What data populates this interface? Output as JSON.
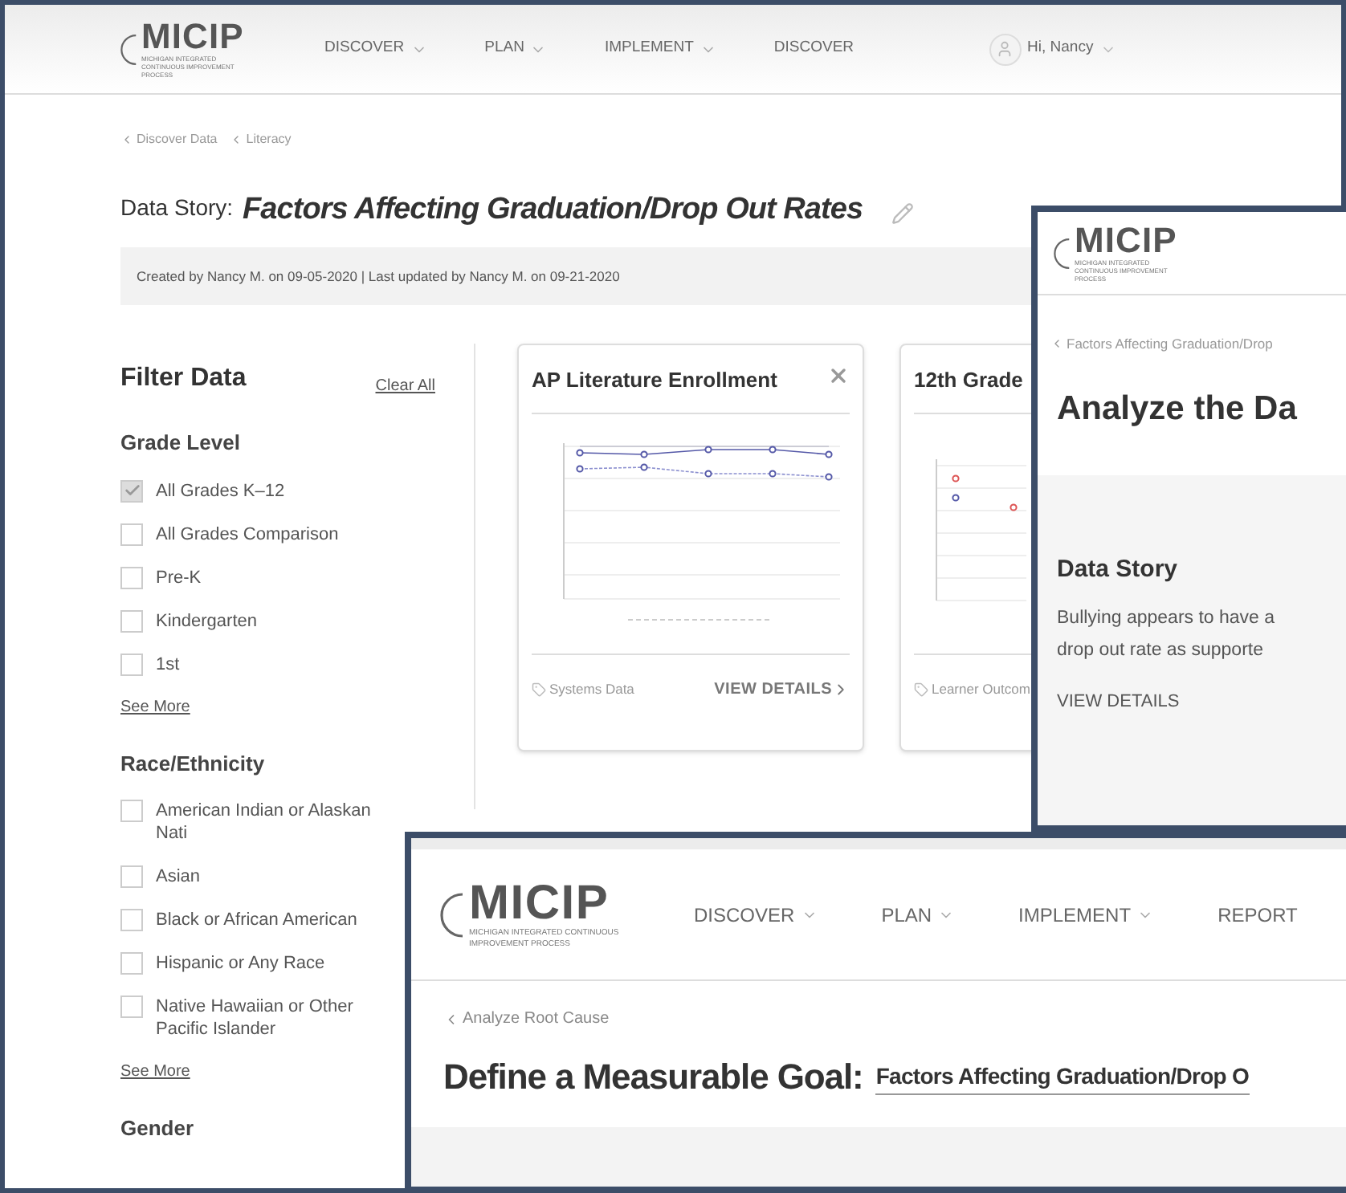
{
  "data_story_window": {
    "logo": {
      "name": "MICIP",
      "subtitle": "MICHIGAN INTEGRATED CONTINUOUS IMPROVEMENT PROCESS"
    },
    "nav": [
      {
        "label": "DISCOVER",
        "dropdown": true
      },
      {
        "label": "PLAN",
        "dropdown": true
      },
      {
        "label": "IMPLEMENT",
        "dropdown": true
      },
      {
        "label": "DISCOVER",
        "dropdown": false
      }
    ],
    "user": {
      "greeting": "Hi, Nancy"
    },
    "breadcrumbs": [
      "Discover Data",
      "Literacy"
    ],
    "title": {
      "prefix": "Data Story:",
      "name": "Factors Affecting Graduation/Drop Out Rates"
    },
    "meta": "Created by Nancy M. on 09-05-2020 | Last updated by Nancy M. on 09-21-2020",
    "filters": {
      "title": "Filter Data",
      "clear": "Clear All",
      "groups": [
        {
          "heading": "Grade Level",
          "options": [
            {
              "label": "All Grades K–12",
              "checked": true
            },
            {
              "label": "All Grades Comparison",
              "checked": false
            },
            {
              "label": "Pre-K",
              "checked": false
            },
            {
              "label": "Kindergarten",
              "checked": false
            },
            {
              "label": "1st",
              "checked": false
            }
          ],
          "see_more": "See More"
        },
        {
          "heading": "Race/Ethnicity",
          "options": [
            {
              "label": "American Indian or Alaskan Nati",
              "checked": false
            },
            {
              "label": "Asian",
              "checked": false
            },
            {
              "label": "Black or African American",
              "checked": false
            },
            {
              "label": "Hispanic or Any Race",
              "checked": false
            },
            {
              "label": "Native Hawaiian or Other Pacific Islander",
              "checked": false
            }
          ],
          "see_more": "See More"
        },
        {
          "heading": "Gender"
        }
      ]
    },
    "cards": [
      {
        "title": "AP Literature Enrollment",
        "closable": true,
        "tag": "Systems Data",
        "action": "VIEW DETAILS"
      },
      {
        "title": "12th Grade",
        "tag": "Learner Outcom"
      }
    ]
  },
  "analyze_window": {
    "logo": {
      "name": "MICIP",
      "subtitle": "MICHIGAN INTEGRATED CONTINUOUS IMPROVEMENT PROCESS"
    },
    "breadcrumb": "Factors Affecting Graduation/Drop",
    "heading": "Analyze the Da",
    "story": {
      "title": "Data Story",
      "lines": [
        "Bullying appears to have a",
        "drop out rate as supporte"
      ],
      "action": "VIEW DETAILS"
    }
  },
  "goal_window": {
    "logo": {
      "name": "MICIP",
      "subtitle": "MICHIGAN INTEGRATED CONTINUOUS IMPROVEMENT PROCESS"
    },
    "nav": [
      {
        "label": "DISCOVER",
        "dropdown": true
      },
      {
        "label": "PLAN",
        "dropdown": true
      },
      {
        "label": "IMPLEMENT",
        "dropdown": true
      },
      {
        "label": "REPORT",
        "dropdown": false
      }
    ],
    "breadcrumb": "Analyze Root Cause",
    "title": {
      "prefix": "Define a Measurable Goal:",
      "name": "Factors Affecting Graduation/Drop O"
    }
  }
}
